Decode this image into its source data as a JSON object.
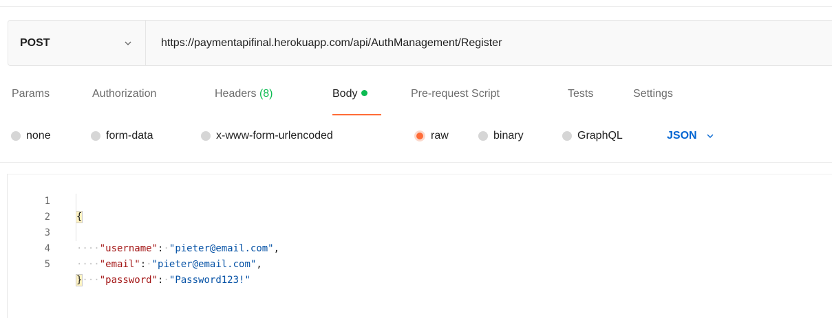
{
  "request": {
    "method": "POST",
    "url": "https://paymentapifinal.herokuapp.com/api/AuthManagement/Register"
  },
  "tabs": [
    {
      "label": "Params"
    },
    {
      "label": "Authorization"
    },
    {
      "label": "Headers",
      "count": "(8)"
    },
    {
      "label": "Body",
      "active": true
    },
    {
      "label": "Pre-request Script"
    },
    {
      "label": "Tests"
    },
    {
      "label": "Settings"
    }
  ],
  "body_types": [
    {
      "label": "none",
      "checked": false
    },
    {
      "label": "form-data",
      "checked": false
    },
    {
      "label": "x-www-form-urlencoded",
      "checked": false
    },
    {
      "label": "raw",
      "checked": true
    },
    {
      "label": "binary",
      "checked": false
    },
    {
      "label": "GraphQL",
      "checked": false
    }
  ],
  "format": "JSON",
  "editor": {
    "lines": [
      {
        "n": "1",
        "text": "{"
      },
      {
        "n": "2",
        "key": "\"username\"",
        "value": "\"pieter@email.com\"",
        "trail": ","
      },
      {
        "n": "3",
        "key": "\"email\"",
        "value": "\"pieter@email.com\"",
        "trail": ","
      },
      {
        "n": "4",
        "key": "\"password\"",
        "value": "\"Password123!\"",
        "trail": ""
      },
      {
        "n": "5",
        "text": "}"
      }
    ]
  },
  "colors": {
    "accent": "#ff6c37",
    "status_dot": "#0cbb52",
    "json_link": "#0265d2",
    "json_key": "#a31515",
    "json_string": "#0451a5"
  }
}
